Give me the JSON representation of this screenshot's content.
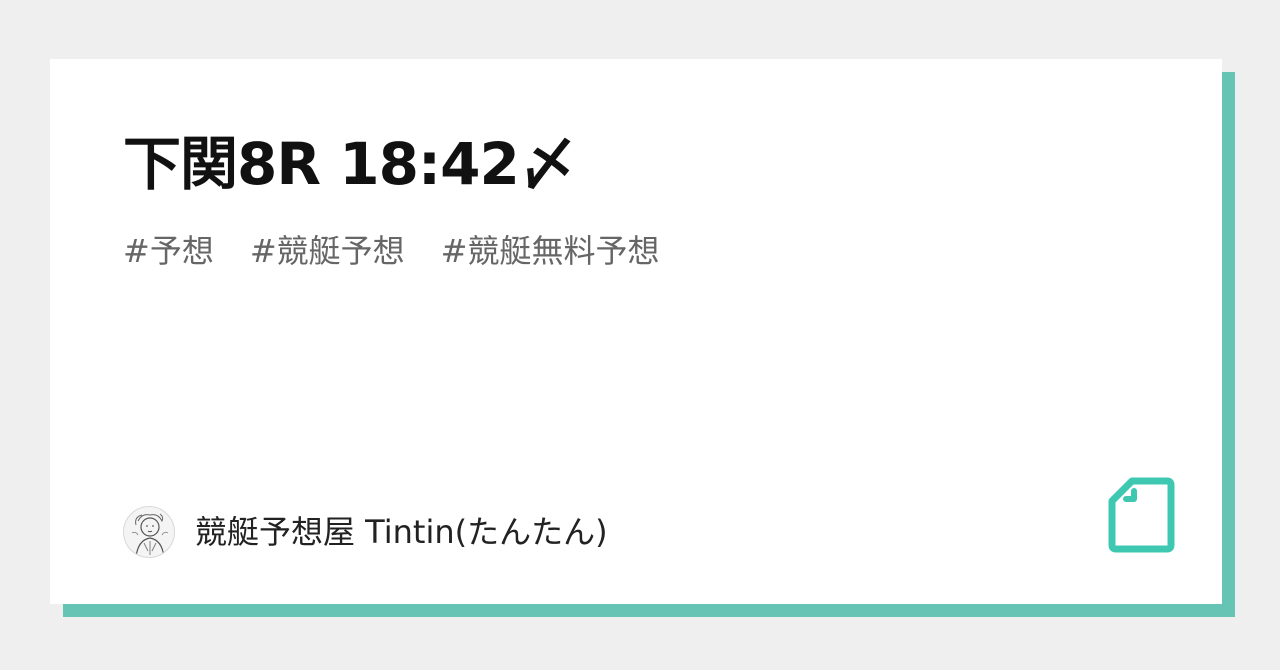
{
  "article": {
    "title": "下関8R 18:42〆",
    "tags": [
      "#予想",
      "#競艇予想",
      "#競艇無料予想"
    ]
  },
  "author": {
    "name": "競艇予想屋 Tintin(たんたん)",
    "avatar_icon": "avatar-illustration"
  },
  "brand": {
    "logo_icon": "note-document-icon",
    "accent_color": "#3ec8b2",
    "shadow_color": "#66c4b5"
  }
}
